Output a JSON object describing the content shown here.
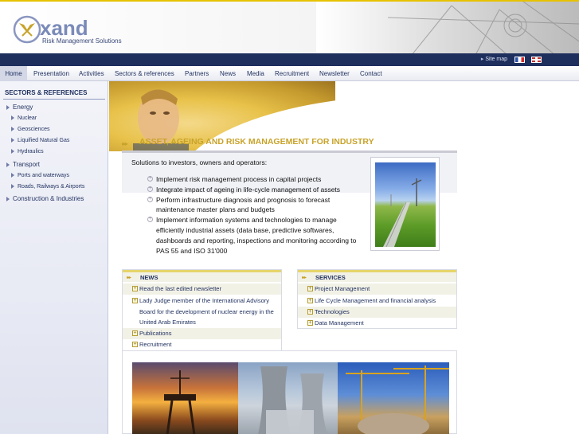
{
  "brand": {
    "name": "xand",
    "tagline": "Risk Management Solutions"
  },
  "topbar": {
    "sitemap": "Site map",
    "flags": [
      "french-flag",
      "english-flag"
    ]
  },
  "menu": {
    "items": [
      "Home",
      "Presentation",
      "Activities",
      "Sectors & references",
      "Partners",
      "News",
      "Media",
      "Recruitment",
      "Newsletter",
      "Contact"
    ],
    "active": "Home"
  },
  "sidebar": {
    "title": "SECTORS & REFERENCES",
    "items": [
      {
        "label": "Energy",
        "level": 1
      },
      {
        "label": "Nuclear",
        "level": 2
      },
      {
        "label": "Geosciences",
        "level": 2
      },
      {
        "label": "Liquified Natural Gas",
        "level": 2
      },
      {
        "label": "Hydraulics",
        "level": 2
      },
      {
        "label": "Transport",
        "level": 1
      },
      {
        "label": "Ports and waterways",
        "level": 2
      },
      {
        "label": "Roads, Railways & Airports",
        "level": 2
      },
      {
        "label": "Construction & Industries",
        "level": 1
      }
    ]
  },
  "main": {
    "headline": "ASSET, AGEING AND RISK MANAGEMENT FOR INDUSTRY",
    "intro": "Solutions to investors, owners and operators:",
    "bullets": [
      "Implement risk management process in capital projects",
      "Integrate impact of ageing in life-cycle management of assets",
      "Perform infrastructure diagnosis and prognosis to forecast maintenance master plans and budgets",
      "Implement information systems and technologies to manage efficiently industrial assets (data base, predictive softwares, dashboards and reporting, inspections and monitoring according to PAS 55 and ISO 31'000"
    ]
  },
  "news": {
    "title": "NEWS",
    "items": [
      "Read the last edited newsletter",
      "Lady Judge member of the International Advisory Board for the development of nuclear energy in the United Arab Emirates",
      "Publications",
      "Recruitment"
    ]
  },
  "services": {
    "title": "SERVICES",
    "items": [
      "Project Management",
      "Life Cycle Management and financial analysis",
      "Technologies",
      "Data Management"
    ]
  },
  "colors": {
    "navy": "#1e2f5e",
    "gold": "#c8a32a",
    "accent_yellow": "#e6d56a"
  }
}
